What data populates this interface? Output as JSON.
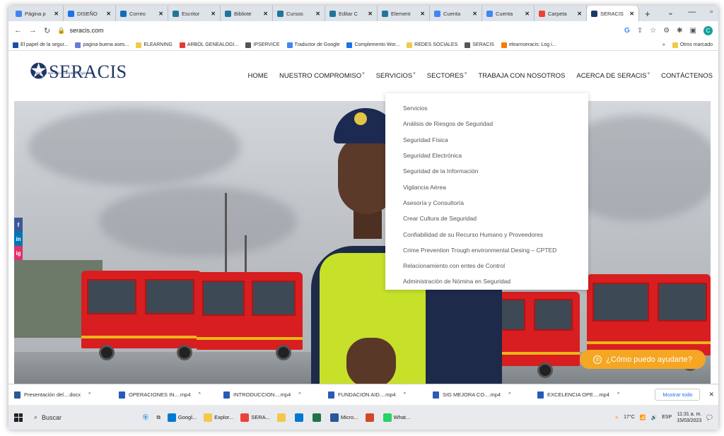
{
  "browser": {
    "tabs": [
      {
        "title": "Página p",
        "color": "#4285f4"
      },
      {
        "title": "DISEÑO",
        "color": "#1a73e8"
      },
      {
        "title": "Correo",
        "color": "#0f6cbd"
      },
      {
        "title": "Escritor",
        "color": "#21759b"
      },
      {
        "title": "Bibliote",
        "color": "#21759b"
      },
      {
        "title": "Cursos",
        "color": "#21759b"
      },
      {
        "title": "Editar C",
        "color": "#21759b"
      },
      {
        "title": "Element",
        "color": "#21759b"
      },
      {
        "title": "Cuenta",
        "color": "#4285f4"
      },
      {
        "title": "Cuenta",
        "color": "#4285f4"
      },
      {
        "title": "Carpeta",
        "color": "#ea4335"
      },
      {
        "title": "SERACIS",
        "color": "#1e3566"
      }
    ],
    "url": "seracis.com",
    "bookmarks": [
      {
        "label": "El papel de la segur...",
        "color": "#1a4fa0"
      },
      {
        "label": "pagina buena ases...",
        "color": "#6b7bd1"
      },
      {
        "label": "ELEARNING",
        "color": "#f2c94c"
      },
      {
        "label": "ARBOL GENEALOGI...",
        "color": "#e53935"
      },
      {
        "label": "IPSERVICE",
        "color": "#555555"
      },
      {
        "label": "Traductor de Google",
        "color": "#4285f4"
      },
      {
        "label": "Complemento Wor...",
        "color": "#1a73e8"
      },
      {
        "label": "REDES SOCIALES",
        "color": "#f2c94c"
      },
      {
        "label": "SERACIS",
        "color": "#555555"
      },
      {
        "label": "elearnseracis: Log i...",
        "color": "#f57c00"
      }
    ],
    "bookmarks_more": "»",
    "bookmarks_other": "Otros marcado",
    "profile_initial": "C"
  },
  "site": {
    "logo_text": "SERACIS",
    "logo_tagline": "Seguridad más allá de la simple Vigilancia",
    "nav": [
      {
        "label": "HOME",
        "caret": false
      },
      {
        "label": "NUESTRO COMPROMISO",
        "caret": true
      },
      {
        "label": "SERVICIOS",
        "caret": true
      },
      {
        "label": "SECTORES",
        "caret": true
      },
      {
        "label": "TRABAJA CON NOSOTROS",
        "caret": false
      },
      {
        "label": "ACERCA DE SERACIS",
        "caret": true
      },
      {
        "label": "CONTÁCTENOS",
        "caret": false
      }
    ],
    "dropdown": [
      "Servicios",
      "Análisis de Riesgos de Seguridad",
      "Seguridad Física",
      "Seguridad Electrónica",
      "Seguridad de la Información",
      "Vigilancia Aérea",
      "Asesoría y Consultoría",
      "Crear Cultura de Seguridad",
      "Confiabilidad de su Recurso Humano y Proveedores",
      "Crime Prevention Trough environmental Desing – CPTED",
      "Relacionamiento con entes de Control",
      "Administración de Nómina en Seguridad"
    ],
    "social": [
      "f",
      "in",
      "ig"
    ],
    "chat_label": "¿Cómo puedo ayudarte?"
  },
  "downloads": {
    "items": [
      {
        "name": "Presentación del....docx",
        "kind": "word"
      },
      {
        "name": "OPERACIONES IN....mp4",
        "kind": "video"
      },
      {
        "name": "INTRODUCCION....mp4",
        "kind": "video"
      },
      {
        "name": "FUNDACION AID....mp4",
        "kind": "video"
      },
      {
        "name": "SIG MEJORA CO....mp4",
        "kind": "video"
      },
      {
        "name": "EXCELENCIA OPE....mp4",
        "kind": "video"
      }
    ],
    "show_all": "Mostrar todo"
  },
  "taskbar": {
    "search_placeholder": "Buscar",
    "apps": [
      {
        "label": "Googl...",
        "color": "#0078d4"
      },
      {
        "label": "Explor...",
        "color": "#f2c94c"
      },
      {
        "label": "SERA...",
        "color": "#ea4335"
      },
      {
        "label": "",
        "color": "#f2c94c"
      },
      {
        "label": "",
        "color": "#0078d4"
      },
      {
        "label": "",
        "color": "#217346"
      },
      {
        "label": "Micro...",
        "color": "#2b579a"
      },
      {
        "label": "",
        "color": "#d24726"
      },
      {
        "label": "What...",
        "color": "#25d366"
      }
    ],
    "weather": "17°C",
    "lang": "ESP",
    "time": "11:31 a. m.",
    "date": "15/03/2023"
  }
}
